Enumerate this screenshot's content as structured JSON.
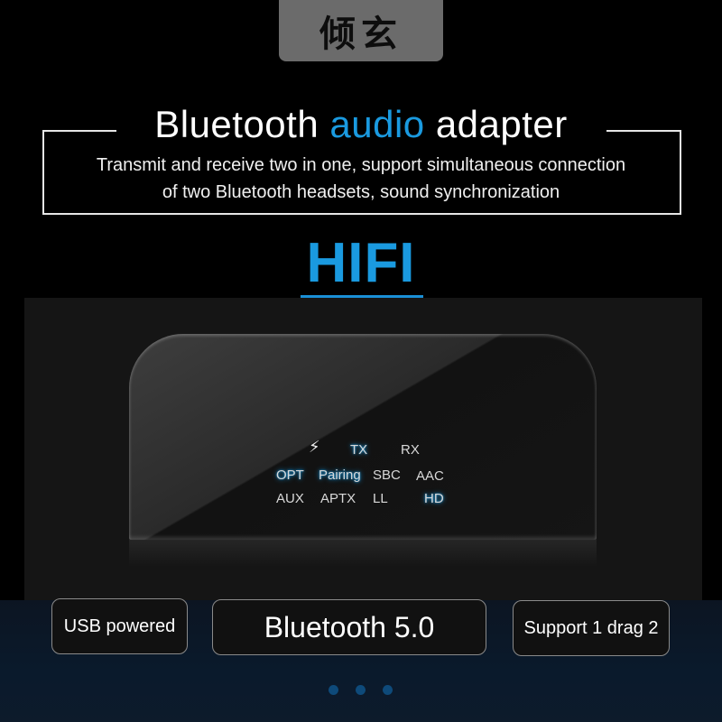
{
  "brand": {
    "name": "倾玄"
  },
  "header": {
    "title_part1": "Bluetooth",
    "title_accent": "audio",
    "title_part2": "adapter",
    "subtitle_line1": "Transmit and receive two in one, support simultaneous connection",
    "subtitle_line2": "of two Bluetooth headsets, sound synchronization"
  },
  "hifi_label": "HIFI",
  "device_panel": {
    "power_icon": "lightning-bolt-icon",
    "indicators": [
      {
        "label": "TX",
        "lit": true
      },
      {
        "label": "RX",
        "lit": false
      },
      {
        "label": "OPT",
        "lit": true
      },
      {
        "label": "Pairing",
        "lit": true
      },
      {
        "label": "SBC",
        "lit": false
      },
      {
        "label": "AAC",
        "lit": false
      },
      {
        "label": "AUX",
        "lit": false
      },
      {
        "label": "APTX",
        "lit": false
      },
      {
        "label": "LL",
        "lit": false
      },
      {
        "label": "HD",
        "lit": true
      }
    ]
  },
  "features": [
    {
      "label": "USB powered"
    },
    {
      "label": "Bluetooth 5.0"
    },
    {
      "label": "Support 1 drag 2"
    }
  ],
  "carousel": {
    "dots": 3
  },
  "colors": {
    "accent": "#1a9ae0",
    "background": "#000000",
    "logo_tab": "#6b6b6b"
  }
}
